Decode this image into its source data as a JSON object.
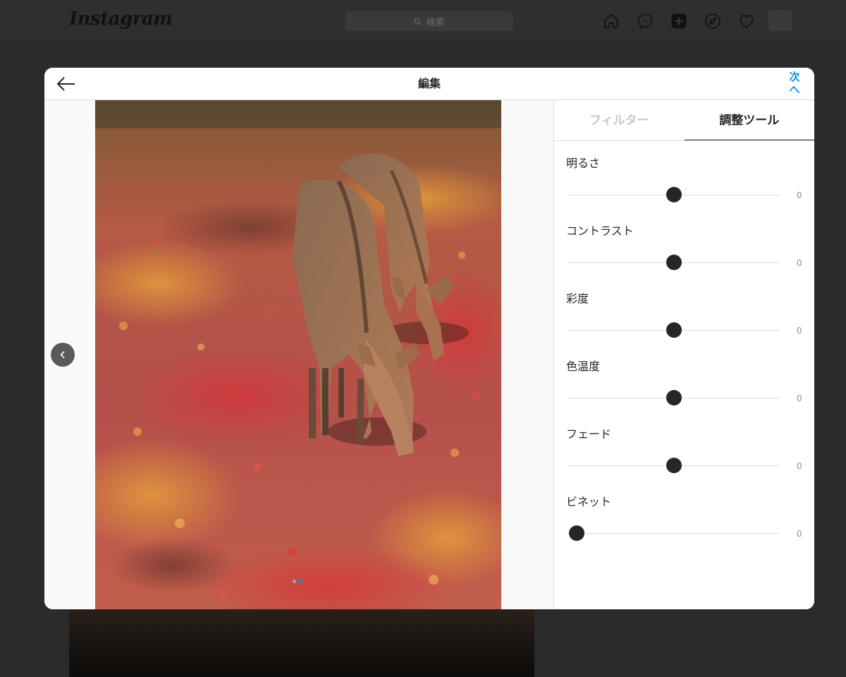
{
  "topnav": {
    "logo": "Instagram",
    "search_placeholder": "検索",
    "icons": [
      "home-icon",
      "messenger-icon",
      "new-post-icon",
      "explore-icon",
      "heart-icon"
    ]
  },
  "modal": {
    "title": "編集",
    "next_label": "次へ",
    "back_icon": "arrow-left-icon",
    "prev_icon": "chevron-left-icon",
    "carousel": {
      "count": 2,
      "active": 1
    }
  },
  "panel": {
    "tabs": [
      {
        "label": "フィルター",
        "active": false
      },
      {
        "label": "調整ツール",
        "active": true
      }
    ],
    "adjustments": [
      {
        "label": "明るさ",
        "value": "0",
        "level": 0.5
      },
      {
        "label": "コントラスト",
        "value": "0",
        "level": 0.5
      },
      {
        "label": "彩度",
        "value": "0",
        "level": 0.5
      },
      {
        "label": "色温度",
        "value": "0",
        "level": 0.5
      },
      {
        "label": "フェード",
        "value": "0",
        "level": 0.5
      },
      {
        "label": "ビネット",
        "value": "0",
        "level": 0.04
      }
    ]
  },
  "colors": {
    "accent": "#0095f6",
    "knob": "#262626",
    "track": "#dbdbdb"
  }
}
